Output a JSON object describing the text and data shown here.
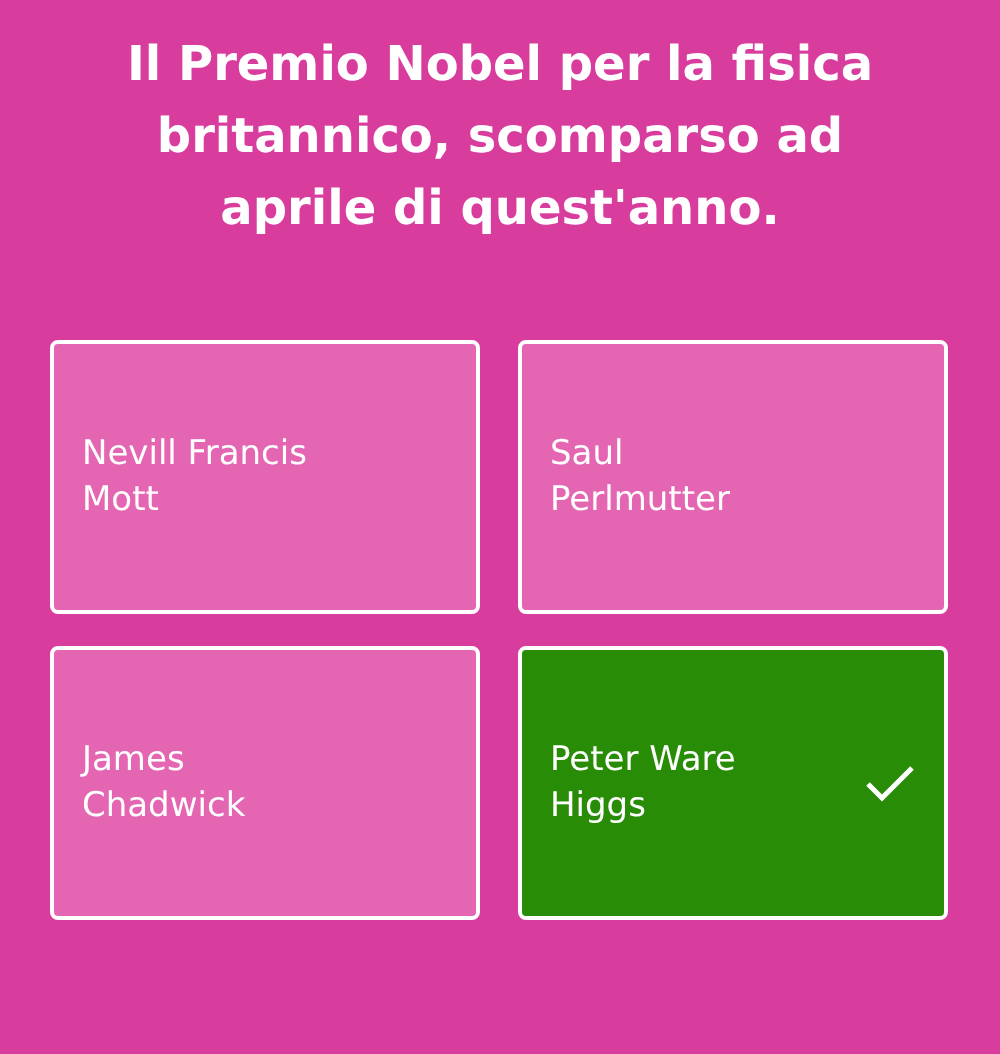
{
  "question": "Il Premio Nobel per la fisica britannico, scomparso ad aprile di quest'anno.",
  "answers": [
    {
      "label": "Nevill Francis Mott",
      "selected": false
    },
    {
      "label": "Saul Perlmutter",
      "selected": false
    },
    {
      "label": "James Chadwick",
      "selected": false
    },
    {
      "label": "Peter Ware Higgs",
      "selected": true
    }
  ]
}
